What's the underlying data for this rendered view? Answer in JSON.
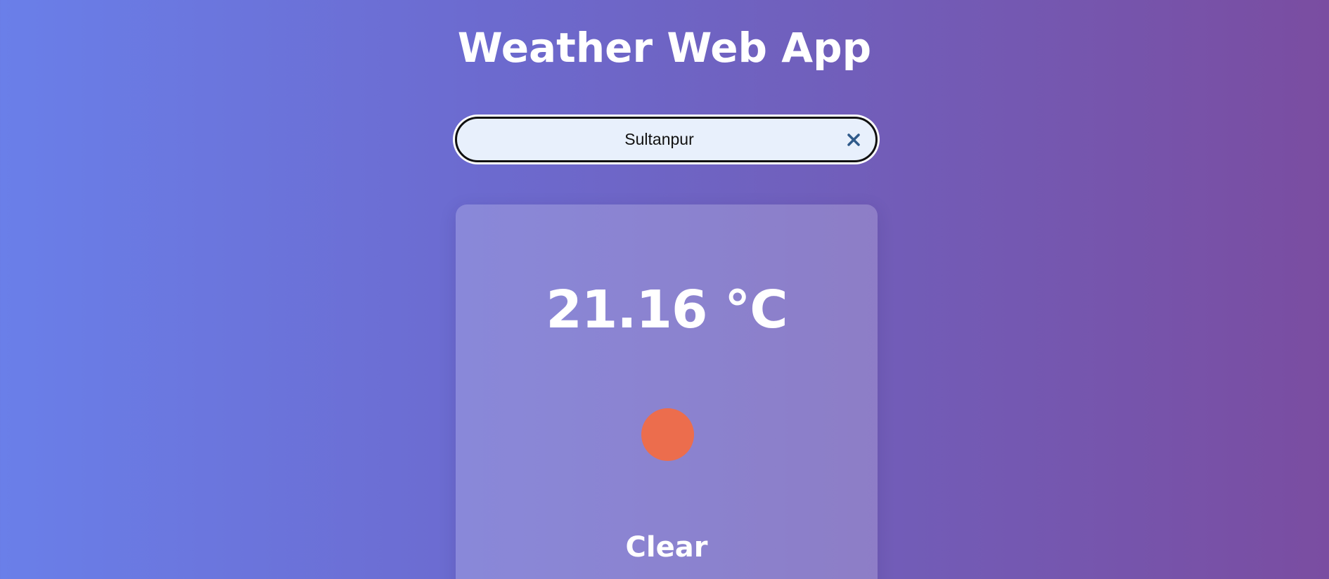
{
  "app": {
    "title": "Weather Web App"
  },
  "search": {
    "value": "Sultanpur",
    "clear_icon": "close-icon"
  },
  "weather": {
    "temperature": "21.16 °C",
    "condition": "Clear",
    "condition_icon": "sun-icon",
    "sun_color": "#ec6d4d"
  },
  "colors": {
    "background_start": "#6a7fe9",
    "background_end": "#7a4da1",
    "input_background": "#e8f0fc",
    "clear_icon": "#2f5a8a"
  }
}
